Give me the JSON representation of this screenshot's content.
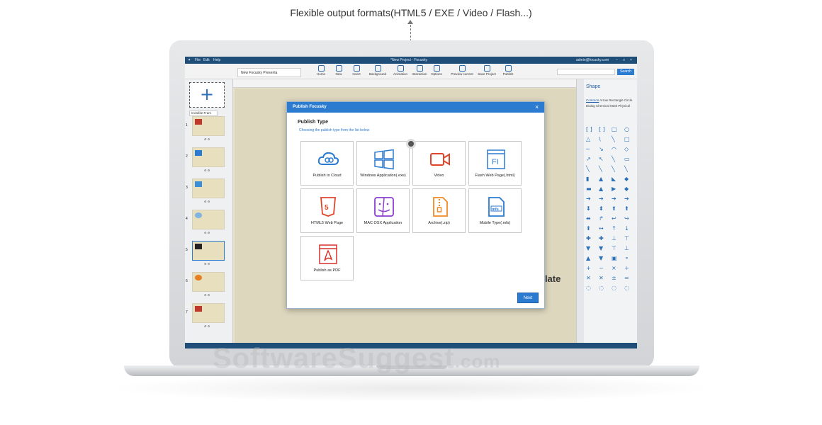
{
  "caption": "Flexible output formats(HTML5 / EXE / Video / Flash...)",
  "watermark": {
    "brand": "SoftwareSuggest",
    "suffix": ".com"
  },
  "app": {
    "menu": [
      "File",
      "Edit",
      "Help"
    ],
    "window_title": "*New Project - Focusky",
    "account": "admin@focusky.com",
    "document_tab": "New Focusky Presenta",
    "toolbar": [
      {
        "label": "Home",
        "icon": "home-icon"
      },
      {
        "label": "New",
        "icon": "new-icon"
      },
      {
        "label": "Insert",
        "icon": "insert-icon"
      },
      {
        "label": "Background",
        "icon": "background-icon"
      },
      {
        "label": "Animation",
        "icon": "animation-icon"
      },
      {
        "label": "Interaction",
        "icon": "interaction-icon"
      },
      {
        "label": "Options",
        "icon": "options-icon"
      },
      {
        "label": "Preview current",
        "icon": "preview-icon"
      },
      {
        "label": "Save Project",
        "icon": "save-icon"
      },
      {
        "label": "Publish",
        "icon": "publish-icon"
      }
    ],
    "search_button": "Search",
    "left_panel": {
      "frame_select": "Invisible Fram",
      "thumb_numbers": [
        "1",
        "2",
        "3",
        "4",
        "5",
        "6",
        "7"
      ]
    },
    "canvas_text": "plate",
    "right_panel": {
      "title": "Shape",
      "tabs": [
        "Common",
        "Arrow",
        "Rectangle",
        "Circle",
        "Dialog",
        "Chemical",
        "Math",
        "Physical"
      ]
    }
  },
  "dialog": {
    "title": "Publish Focusky",
    "heading": "Publish Type",
    "subtitle": "Choosing the publish type from the list below",
    "options": [
      {
        "label": "Publish to Cloud",
        "icon": "cloud-icon",
        "color": "#2b7bd1"
      },
      {
        "label": "Windows Application(.exe)",
        "icon": "windows-icon",
        "color": "#2b7bd1"
      },
      {
        "label": "Video",
        "icon": "video-icon",
        "color": "#e0452b"
      },
      {
        "label": "Flash Web Page(.html)",
        "icon": "flash-page-icon",
        "color": "#2b7bd1"
      },
      {
        "label": "HTML5 Web Page",
        "icon": "html5-icon",
        "color": "#e0452b"
      },
      {
        "label": "MAC OSX Application",
        "icon": "mac-finder-icon",
        "color": "#8a3fd1"
      },
      {
        "label": "Archive(.zip)",
        "icon": "zip-icon",
        "color": "#f08a24"
      },
      {
        "label": "Mobile Type(.mfs)",
        "icon": "mobile-mfs-icon",
        "color": "#2b7bd1"
      },
      {
        "label": "Publish as PDF",
        "icon": "pdf-icon",
        "color": "#d6312b"
      }
    ],
    "next_label": "Next"
  }
}
